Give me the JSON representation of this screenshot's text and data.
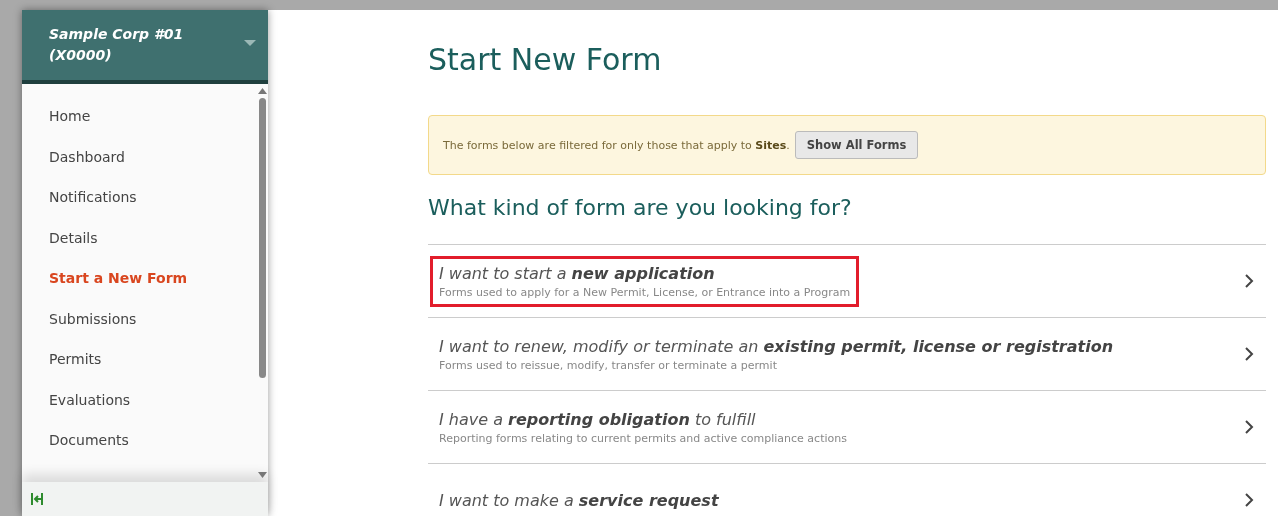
{
  "sidebar": {
    "account": "Sample Corp #01 (X0000)",
    "items": [
      {
        "label": "Home",
        "selected": false
      },
      {
        "label": "Dashboard",
        "selected": false
      },
      {
        "label": "Notifications",
        "selected": false
      },
      {
        "label": "Details",
        "selected": false
      },
      {
        "label": "Start a New Form",
        "selected": true
      },
      {
        "label": "Submissions",
        "selected": false
      },
      {
        "label": "Permits",
        "selected": false
      },
      {
        "label": "Evaluations",
        "selected": false
      },
      {
        "label": "Documents",
        "selected": false
      }
    ]
  },
  "main": {
    "title": "Start New Form",
    "notice": {
      "text": "The forms below are filtered for only those that apply to **Sites**.",
      "button": "Show All Forms"
    },
    "heading": "What kind of form are you looking for?",
    "options": [
      {
        "title": "I want to start a **new application**",
        "description": "Forms used to apply for a New Permit, License, or Entrance into a Program",
        "highlighted": true
      },
      {
        "title": "I want to renew, modify or terminate an **existing permit, license or registration**",
        "description": "Forms used to reissue, modify, transfer or terminate a permit",
        "highlighted": false
      },
      {
        "title": "I have a **reporting obligation** to fulfill",
        "description": "Reporting forms relating to current permits and active compliance actions",
        "highlighted": false
      },
      {
        "title": "I want to make a **service request**",
        "highlighted": false
      }
    ]
  }
}
